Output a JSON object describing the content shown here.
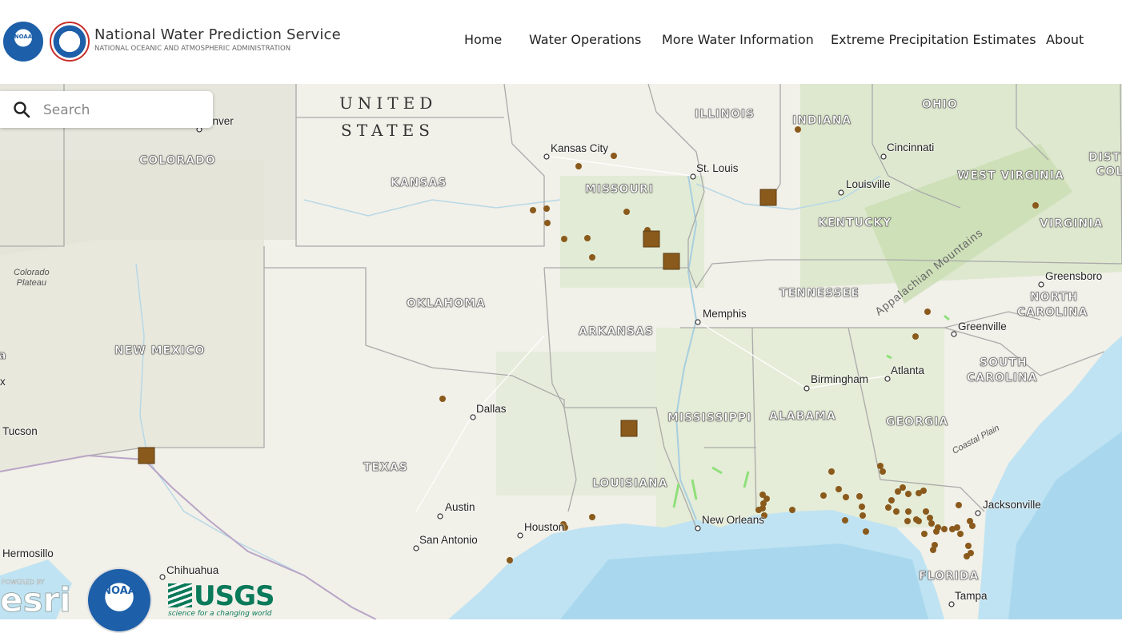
{
  "header": {
    "title": "National Water Prediction Service",
    "subtitle": "NATIONAL OCEANIC AND ATMOSPHERIC ADMINISTRATION",
    "noaa_logo_text": "NOAA",
    "nav": [
      "Home",
      "Water Operations",
      "More Water Information",
      "Extreme Precipitation Estimates",
      "About"
    ]
  },
  "search": {
    "placeholder": "Search"
  },
  "map": {
    "country_label": [
      "UNITED",
      "STATES"
    ],
    "states": [
      "COLORADO",
      "KANSAS",
      "MISSOURI",
      "ILLINOIS",
      "INDIANA",
      "OHIO",
      "WEST VIRGINIA",
      "VIRGINIA",
      "KENTUCKY",
      "TENNESSEE",
      "NORTH",
      "CAROLINA",
      "SOUTH",
      "CAROLINA",
      "OKLAHOMA",
      "ARKANSAS",
      "NEW MEXICO",
      "TEXAS",
      "LOUISIANA",
      "MISSISSIPPI",
      "ALABAMA",
      "GEORGIA",
      "FLORIDA",
      "DIST",
      "COL"
    ],
    "cities": [
      "enver",
      "Kansas City",
      "St. Louis",
      "Louisville",
      "Cincinnati",
      "Memphis",
      "Greensboro",
      "Greenville",
      "Birmingham",
      "Atlanta",
      "Dallas",
      "Austin",
      "San Antonio",
      "Houston",
      "New Orleans",
      "Jacksonville",
      "Tampa",
      "Tucson",
      "Hermosillo",
      "Chihuahua"
    ],
    "physical": [
      "Colorado",
      "Plateau",
      "Appalachian Mountains",
      "Coastal Plain"
    ],
    "edge_labels": [
      "a",
      "x"
    ],
    "marker_color": "#8a5a1c"
  },
  "attribution": {
    "esri_top": "POWERED BY",
    "esri": "esri",
    "noaa": "NOAA",
    "usgs": "USGS",
    "usgs_tag": "science for a changing world"
  }
}
